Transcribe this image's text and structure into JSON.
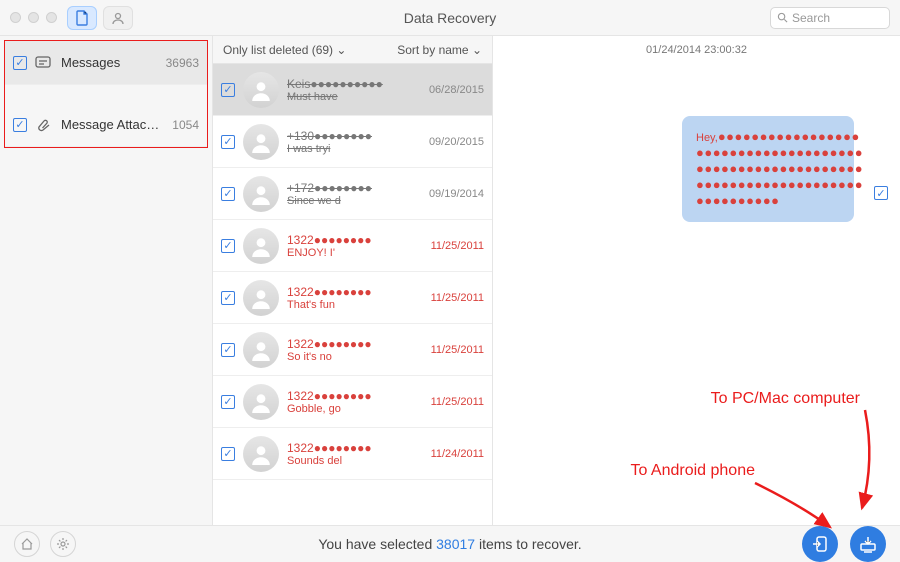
{
  "title": "Data Recovery",
  "search_placeholder": "Search",
  "sidebar": {
    "items": [
      {
        "label": "Messages",
        "count": "36963"
      },
      {
        "label": "Message Attac…",
        "count": "1054"
      }
    ]
  },
  "mid": {
    "filter_label": "Only list deleted (69)",
    "sort_label": "Sort by name",
    "conversations": [
      {
        "name": "Keis●●●●●●●●●●",
        "snippet": "Must have",
        "date": "06/28/2015",
        "style": "old",
        "selected": true
      },
      {
        "name": "+130●●●●●●●●",
        "snippet": "I was tryi",
        "date": "09/20/2015",
        "style": "old"
      },
      {
        "name": "+172●●●●●●●●",
        "snippet": "Since we d",
        "date": "09/19/2014",
        "style": "old"
      },
      {
        "name": "1322●●●●●●●●",
        "snippet": "ENJOY!  I'",
        "date": "11/25/2011",
        "style": "del"
      },
      {
        "name": "1322●●●●●●●●",
        "snippet": "That's fun",
        "date": "11/25/2011",
        "style": "del"
      },
      {
        "name": "1322●●●●●●●●",
        "snippet": "So it's no",
        "date": "11/25/2011",
        "style": "del"
      },
      {
        "name": "1322●●●●●●●●",
        "snippet": "Gobble, go",
        "date": "11/25/2011",
        "style": "del"
      },
      {
        "name": "1322●●●●●●●●",
        "snippet": "Sounds del",
        "date": "11/24/2011",
        "style": "del"
      }
    ]
  },
  "preview": {
    "timestamp": "01/24/2014 23:00:32",
    "bubble_prefix": "Hey,",
    "bubble_lines": [
      "●●●●●●●●●●●●●●●●●",
      "●●●●●●●●●●●●●●●●●●●●",
      "●●●●●●●●●●●●●●●●●●●●",
      "●●●●●●●●●●●●●●●●●●●●",
      "●●●●●●●●●●"
    ]
  },
  "footer": {
    "prefix": "You have selected ",
    "count": "38017",
    "suffix": " items to recover."
  },
  "annotations": {
    "to_pc": "To PC/Mac computer",
    "to_android": "To Android phone"
  }
}
